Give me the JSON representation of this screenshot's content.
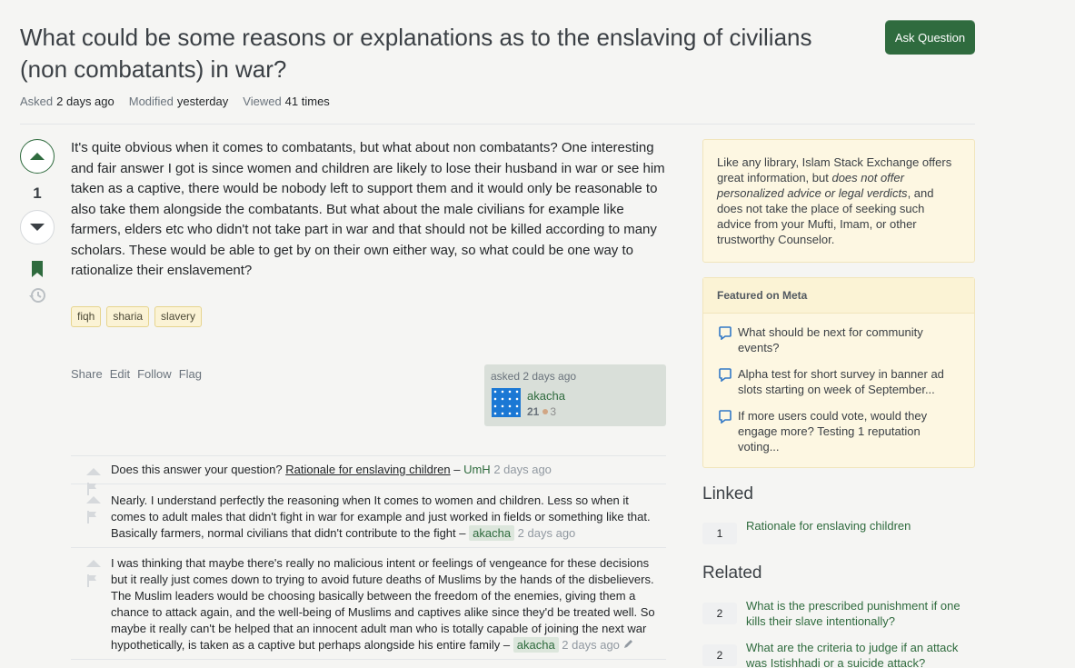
{
  "question": {
    "title": "What could be some reasons or explanations as to the enslaving of civilians (non combatants) in war?",
    "ask_button": "Ask Question",
    "meta": {
      "asked_label": "Asked",
      "asked_value": "2 days ago",
      "modified_label": "Modified",
      "modified_value": "yesterday",
      "viewed_label": "Viewed",
      "viewed_value": "41 times"
    },
    "score": "1",
    "body": "It's quite obvious when it comes to combatants, but what about non combatants? One interesting and fair answer I got is since women and children are likely to lose their husband in war or see him taken as a captive, there would be nobody left to support them and it would only be reasonable to also take them alongside the combatants. But what about the male civilians for example like farmers, elders etc who didn't not take part in war and that should not be killed according to many scholars. These would be able to get by on their own either way, so what could be one way to rationalize their enslavement?",
    "tags": [
      "fiqh",
      "sharia",
      "slavery"
    ],
    "menu": [
      "Share",
      "Edit",
      "Follow",
      "Flag"
    ],
    "owner": {
      "asked": "asked 2 days ago",
      "name": "akacha",
      "rep": "21",
      "bronze": "3"
    }
  },
  "comments": [
    {
      "pre": "Does this answer your question? ",
      "link": "Rationale for enslaving children",
      "sep": " – ",
      "user": "UmH",
      "date": "2 days ago",
      "user_highlight": false
    },
    {
      "pre": "Nearly. I understand perfectly the reasoning when It comes to women and children. Less so when it comes to adult males that didn't fight in war for example and just worked in fields or something like that. Basically farmers, normal civilians that didn't contribute to the fight",
      "link": "",
      "sep": " – ",
      "user": "akacha",
      "date": "2 days ago",
      "user_highlight": true
    },
    {
      "pre": "I was thinking that maybe there's really no malicious intent or feelings of vengeance for these decisions but it really just comes down to trying to avoid future deaths of Muslims by the hands of the disbelievers. The Muslim leaders would be choosing basically between the freedom of the enemies, giving them a chance to attack again, and the well-being of Muslims and captives alike since they'd be treated well. So maybe it really can't be helped that an innocent adult man who is totally capable of joining the next war hypothetically, is taken as a captive but perhaps alongside his entire family",
      "link": "",
      "sep": " – ",
      "user": "akacha",
      "date": "2 days ago",
      "user_highlight": true
    }
  ],
  "sidebar": {
    "notice_a": "Like any library, Islam Stack Exchange offers great information, but ",
    "notice_em": "does not offer personalized advice or legal verdicts",
    "notice_b": ", and does not take the place of seeking such advice from your Mufti, Imam, or other trustworthy Counselor.",
    "featured_title": "Featured on Meta",
    "featured": [
      "What should be next for community events?",
      "Alpha test for short survey in banner ad slots starting on week of September...",
      "If more users could vote, would they engage more? Testing 1 reputation voting..."
    ],
    "linked_title": "Linked",
    "linked": [
      {
        "count": "1",
        "title": "Rationale for enslaving children"
      }
    ],
    "related_title": "Related",
    "related": [
      {
        "count": "2",
        "title": "What is the prescribed punishment if one kills their slave intentionally?"
      },
      {
        "count": "2",
        "title": "What are the criteria to judge if an attack was Istishhadi or a suicide attack?"
      }
    ]
  },
  "colors": {
    "accent": "#2f6b3e",
    "notice_bg": "#fdf7e2",
    "tag_bg": "#fbf3d5"
  }
}
